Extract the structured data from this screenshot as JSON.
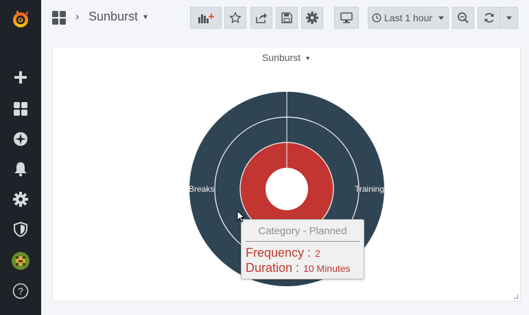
{
  "sidebar": {
    "items": [
      {
        "icon": "grafana-logo-icon"
      },
      {
        "icon": "plus-icon"
      },
      {
        "icon": "dashboards-icon"
      },
      {
        "icon": "explore-compass-icon"
      },
      {
        "icon": "alerting-bell-icon"
      },
      {
        "icon": "configuration-gear-icon"
      },
      {
        "icon": "server-admin-shield-icon"
      },
      {
        "icon": "user-avatar-icon"
      },
      {
        "icon": "help-icon"
      }
    ]
  },
  "header": {
    "title": "Sunburst",
    "time_picker": "Last 1 hour",
    "buttons": [
      "add-panel",
      "star",
      "share",
      "save",
      "settings",
      "tv-mode",
      "time-picker",
      "zoom-out",
      "refresh",
      "refresh-interval"
    ]
  },
  "panel": {
    "title": "Sunburst"
  },
  "chart_data": {
    "type": "sunburst",
    "inner_ring_color": "#c23531",
    "outer_ring_color": "#2f4554",
    "labels": [
      "Breaks",
      "Training"
    ],
    "tooltip": {
      "title": "Category - Planned",
      "rows": [
        {
          "key": "Frequency :",
          "value": "2"
        },
        {
          "key": "Duration :",
          "value": "10 Minutes"
        }
      ]
    }
  },
  "colors": {
    "sidebar_bg": "#1f2329",
    "page_bg": "#f4f5f8",
    "accent_orange": "#f05a28",
    "tooltip_text": "#c0392b"
  }
}
